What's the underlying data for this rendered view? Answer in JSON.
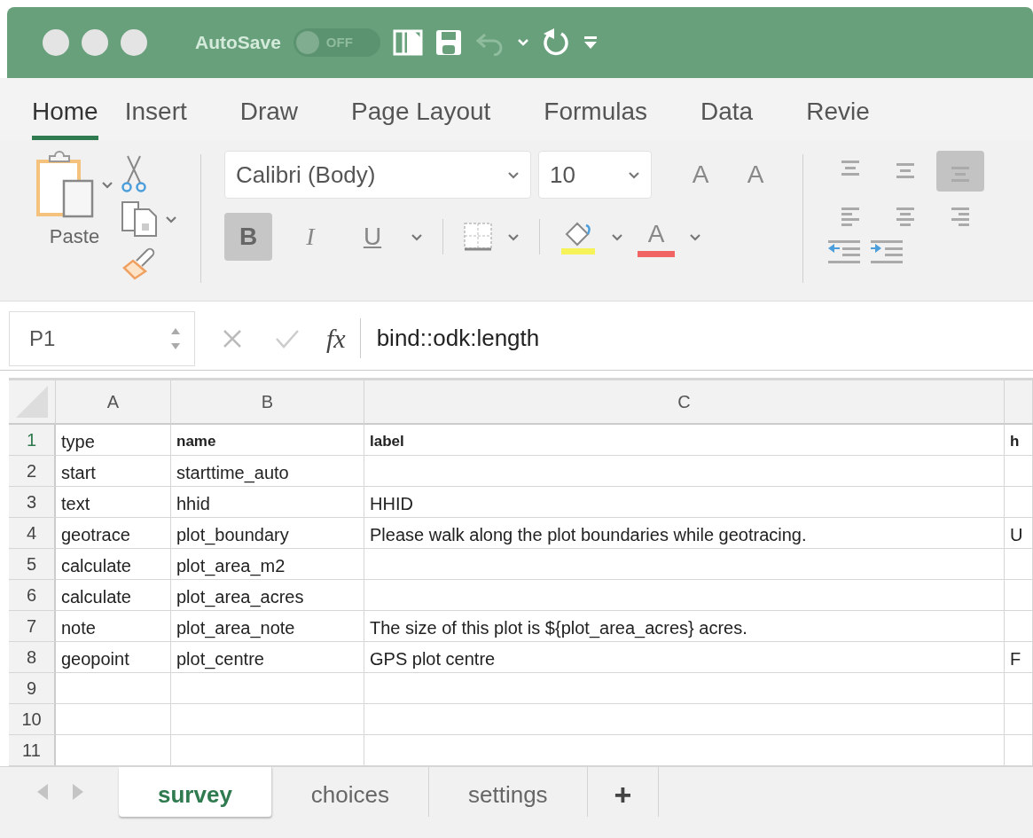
{
  "title_bar": {
    "autosave_label": "AutoSave",
    "autosave_toggle": {
      "label": "OFF",
      "on": false
    }
  },
  "ribbon_tabs": [
    {
      "label": "Home",
      "selected": true
    },
    {
      "label": "Insert",
      "selected": false
    },
    {
      "label": "Draw",
      "selected": false
    },
    {
      "label": "Page Layout",
      "selected": false
    },
    {
      "label": "Formulas",
      "selected": false
    },
    {
      "label": "Data",
      "selected": false
    },
    {
      "label": "Revie",
      "selected": false
    }
  ],
  "ribbon": {
    "paste_label": "Paste",
    "font_name": "Calibri (Body)",
    "font_size": "10",
    "grow_font": "A",
    "shrink_font": "A",
    "format_buttons": [
      {
        "label": "B",
        "kind": "bold",
        "selected": true
      },
      {
        "label": "I",
        "kind": "italic",
        "selected": false
      },
      {
        "label": "U",
        "kind": "underline",
        "selected": false
      }
    ],
    "font_color": {
      "label": "A",
      "color": "#f06464"
    },
    "align_buttons": [
      {
        "kind": "top",
        "selected": false
      },
      {
        "kind": "middle",
        "selected": false
      },
      {
        "kind": "bottom",
        "selected": true
      },
      {
        "kind": "left",
        "selected": false
      },
      {
        "kind": "center",
        "selected": false
      },
      {
        "kind": "right",
        "selected": false
      }
    ]
  },
  "formula_bar": {
    "name_box": "P1",
    "fx": "fx",
    "formula": "bind::odk:length"
  },
  "sheet": {
    "columns": [
      "A",
      "B",
      "C"
    ],
    "header_row": {
      "number": "1",
      "selected": true,
      "cells": [
        "type",
        "name",
        "label",
        "h"
      ]
    },
    "rows": [
      {
        "number": "2",
        "selected": false,
        "cells": [
          "start",
          "starttime_auto",
          "",
          ""
        ]
      },
      {
        "number": "3",
        "selected": false,
        "cells": [
          "text",
          "hhid",
          "HHID",
          ""
        ]
      },
      {
        "number": "4",
        "selected": false,
        "cells": [
          "geotrace",
          "plot_boundary",
          "Please walk along the plot boundaries while geotracing.",
          "U"
        ]
      },
      {
        "number": "5",
        "selected": false,
        "cells": [
          "calculate",
          "plot_area_m2",
          "",
          ""
        ]
      },
      {
        "number": "6",
        "selected": false,
        "cells": [
          "calculate",
          "plot_area_acres",
          "",
          ""
        ]
      },
      {
        "number": "7",
        "selected": false,
        "cells": [
          "note",
          "plot_area_note",
          "The size of this plot is ${plot_area_acres} acres.",
          ""
        ]
      },
      {
        "number": "8",
        "selected": false,
        "cells": [
          "geopoint",
          "plot_centre",
          "GPS plot centre",
          "F"
        ]
      },
      {
        "number": "9",
        "selected": false,
        "cells": [
          "",
          "",
          "",
          ""
        ]
      },
      {
        "number": "10",
        "selected": false,
        "cells": [
          "",
          "",
          "",
          ""
        ]
      },
      {
        "number": "11",
        "selected": false,
        "cells": [
          "",
          "",
          "",
          ""
        ]
      }
    ]
  },
  "sheet_tabs": [
    {
      "label": "survey",
      "selected": true
    },
    {
      "label": "choices",
      "selected": false
    },
    {
      "label": "settings",
      "selected": false
    }
  ],
  "add_sheet": "+"
}
